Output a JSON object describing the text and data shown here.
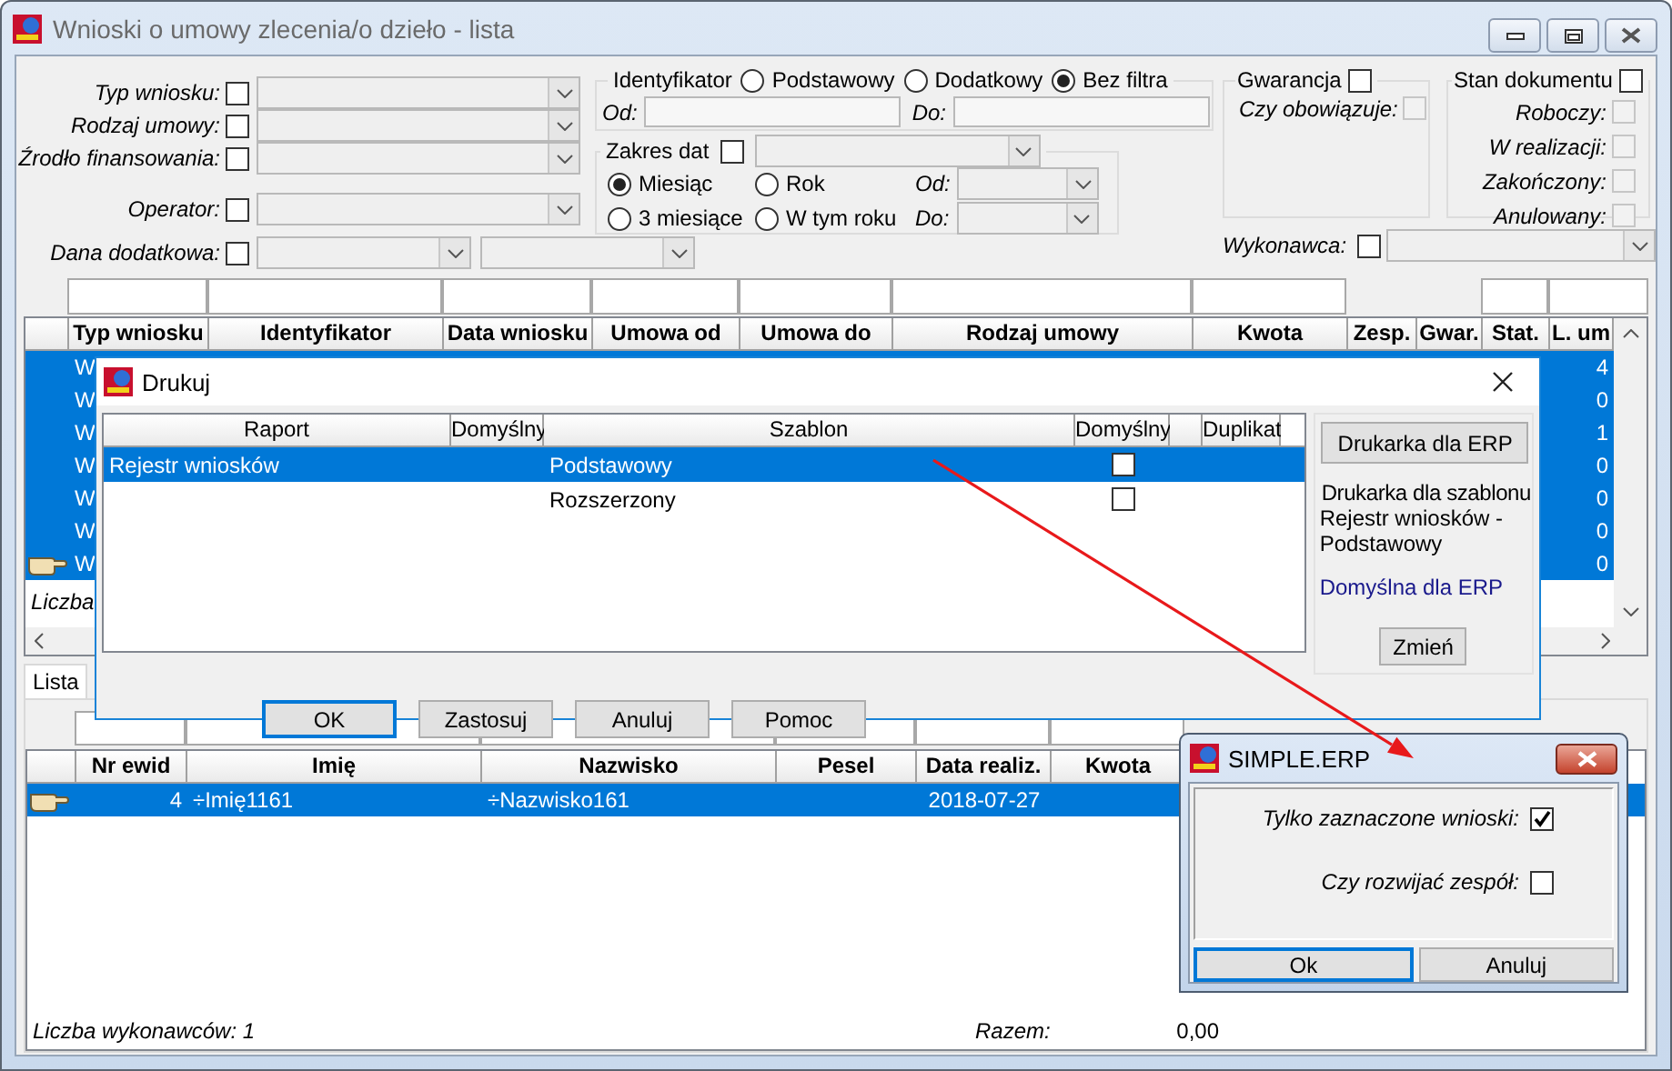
{
  "main_window": {
    "title": "Wnioski o umowy zlecenia/o dzieło - lista",
    "filters": {
      "rows": [
        {
          "label": "Typ wniosku:",
          "checked": false,
          "kind": "single"
        },
        {
          "label": "Rodzaj umowy:",
          "checked": false,
          "kind": "single"
        },
        {
          "label": "Źrodło finansowania:",
          "checked": false,
          "kind": "single"
        },
        {
          "label": "Operator:",
          "checked": false,
          "kind": "single"
        },
        {
          "label": "Dana dodatkowa:",
          "checked": false,
          "kind": "double"
        }
      ],
      "identyfikator": {
        "title": "Identyfikator",
        "options": [
          {
            "label": "Podstawowy",
            "selected": false
          },
          {
            "label": "Dodatkowy",
            "selected": false
          },
          {
            "label": "Bez filtra",
            "selected": true
          }
        ],
        "fields": [
          {
            "label": "Od:"
          },
          {
            "label": "Do:"
          }
        ]
      },
      "zakres_dat": {
        "title": "Zakres dat",
        "checked": false,
        "options": [
          {
            "label": "Miesiąc",
            "selected": true
          },
          {
            "label": "Rok",
            "selected": false
          },
          {
            "label": "3 miesiące",
            "selected": false
          },
          {
            "label": "W tym roku",
            "selected": false
          }
        ],
        "fields": [
          {
            "label": "Od:"
          },
          {
            "label": "Do:"
          }
        ]
      },
      "gwarancja": {
        "title": "Gwarancja",
        "checked": false,
        "items": [
          {
            "label": "Czy obowiązuje:",
            "checked": false,
            "disabled": true
          }
        ]
      },
      "stan_dokumentu": {
        "title": "Stan dokumentu",
        "checked": false,
        "items": [
          {
            "label": "Roboczy:",
            "checked": false,
            "disabled": true
          },
          {
            "label": "W realizacji:",
            "checked": false,
            "disabled": true
          },
          {
            "label": "Zakończony:",
            "checked": false,
            "disabled": true
          },
          {
            "label": "Anulowany:",
            "checked": false,
            "disabled": true
          }
        ]
      },
      "wykonawca": {
        "label": "Wykonawca:",
        "checked": false
      }
    },
    "upper_table": {
      "columns": [
        {
          "kind": "indicator",
          "filter": false
        },
        {
          "label": "Typ wniosku",
          "filter": true
        },
        {
          "label": "Identyfikator",
          "filter": true
        },
        {
          "label": "Data wniosku",
          "filter": true
        },
        {
          "label": "Umowa od",
          "filter": true
        },
        {
          "label": "Umowa do",
          "filter": true
        },
        {
          "label": "Rodzaj umowy",
          "filter": true
        },
        {
          "label": "Kwota",
          "filter": true
        },
        {
          "label": "Zesp.",
          "filter": false
        },
        {
          "label": "Gwar.",
          "filter": false
        },
        {
          "label": "Stat.",
          "filter": true
        },
        {
          "label": "L. um",
          "filter": true
        }
      ],
      "rows": [
        {
          "typ_wniosku": "W",
          "l_um": "4",
          "selected": true,
          "pointer": false
        },
        {
          "typ_wniosku": "W",
          "l_um": "0",
          "selected": true,
          "pointer": false
        },
        {
          "typ_wniosku": "W",
          "l_um": "1",
          "selected": true,
          "pointer": false
        },
        {
          "typ_wniosku": "W",
          "l_um": "0",
          "selected": true,
          "pointer": false
        },
        {
          "typ_wniosku": "W",
          "l_um": "0",
          "selected": true,
          "pointer": false
        },
        {
          "typ_wniosku": "W",
          "l_um": "0",
          "selected": true,
          "pointer": false
        },
        {
          "typ_wniosku": "W",
          "l_um": "0",
          "selected": true,
          "pointer": true
        }
      ],
      "footer": "Liczba"
    },
    "tab": {
      "label": "Lista",
      "selected": true
    },
    "lower_table": {
      "columns": [
        {
          "kind": "indicator",
          "filter": false
        },
        {
          "label": "Nr ewid",
          "filter": true
        },
        {
          "label": "Imię",
          "filter": true
        },
        {
          "label": "Nazwisko",
          "filter": true
        },
        {
          "label": "Pesel",
          "filter": true
        },
        {
          "label": "Data realiz.",
          "filter": true
        },
        {
          "label": "Kwota",
          "filter": true
        }
      ],
      "rows": [
        {
          "nr_ewid": "4",
          "imie": "÷Imię1161",
          "nazwisko": "÷Nazwisko161",
          "data_realiz": "2018-07-27",
          "selected": true,
          "pointer": true
        }
      ],
      "footer": "Liczba wykonawców: 1",
      "total_label": "Razem:",
      "total": "0,00"
    }
  },
  "print_dialog": {
    "title": "Drukuj",
    "columns": [
      {
        "label": "Raport"
      },
      {
        "label": "Domyślny"
      },
      {
        "label": "Szablon"
      },
      {
        "label": "Domyślny",
        "kind": "check"
      },
      {
        "kind": "blank"
      },
      {
        "label": "Duplikat"
      }
    ],
    "rows": [
      {
        "raport": "Rejestr wniosków",
        "szablon": "Podstawowy",
        "szablon_default": false,
        "selected": true
      },
      {
        "szablon": "Rozszerzony",
        "szablon_default": false,
        "selected": false
      }
    ],
    "printer_button": "Drukarka dla ERP",
    "template_label": "Drukarka dla szablonu",
    "template_name": "Rejestr wniosków - Podstawowy",
    "printer": "Domyślna dla ERP",
    "change_button": "Zmień",
    "buttons": [
      {
        "label": "OK",
        "focused": true
      },
      {
        "label": "Zastosuj",
        "focused": false
      },
      {
        "label": "Anuluj",
        "focused": false
      },
      {
        "label": "Pomoc",
        "focused": false
      }
    ]
  },
  "erp_dialog": {
    "title": "SIMPLE.ERP",
    "options": [
      {
        "label": "Tylko zaznaczone wnioski:",
        "checked": true
      },
      {
        "label": "Czy rozwijać zespół:",
        "checked": false
      }
    ],
    "buttons": [
      {
        "label": "Ok",
        "focused": true
      },
      {
        "label": "Anuluj",
        "focused": false
      }
    ]
  }
}
